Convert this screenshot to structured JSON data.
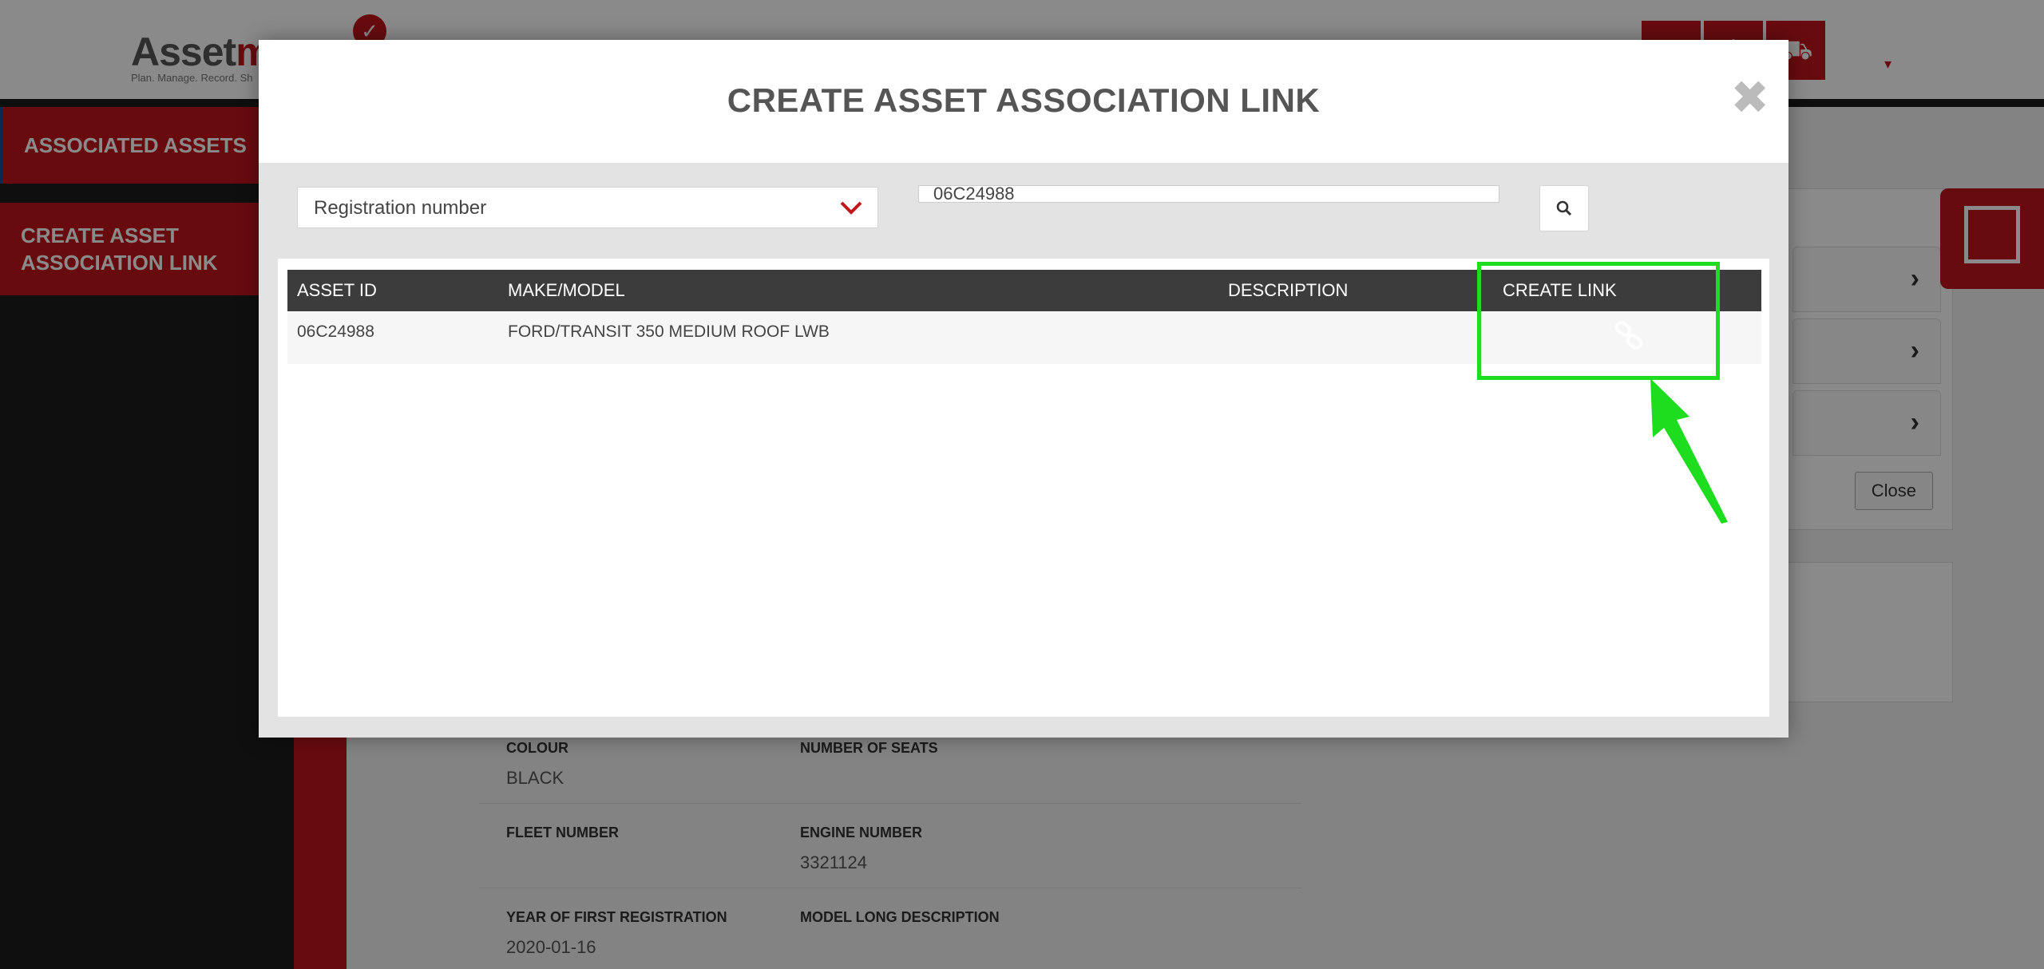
{
  "app": {
    "logo_text_main": "Asset",
    "logo_text_accent": "m",
    "logo_tagline": "Plan. Manage. Record. Sh",
    "logo_check": "✓"
  },
  "topbar": {
    "buttons": [
      "home-icon",
      "settings-icon",
      "truck-icon"
    ],
    "caret": "▾"
  },
  "sidebar": {
    "items": [
      {
        "label": "ASSOCIATED ASSETS"
      },
      {
        "label": "CREATE ASSET ASSOCIATION LINK"
      }
    ]
  },
  "details": {
    "rows": [
      {
        "left_label": "COLOUR",
        "left_value": "BLACK",
        "right_label": "NUMBER OF SEATS",
        "right_value": ""
      },
      {
        "left_label": "FLEET NUMBER",
        "left_value": "",
        "right_label": "ENGINE NUMBER",
        "right_value": "3321124"
      },
      {
        "left_label": "YEAR OF FIRST REGISTRATION",
        "left_value": "2020-01-16",
        "right_label": "MODEL LONG DESCRIPTION",
        "right_value": ""
      }
    ]
  },
  "right_panel": {
    "close_label": "Close"
  },
  "modal": {
    "title": "CREATE ASSET ASSOCIATION LINK",
    "close_glyph": "✖",
    "search_type": "Registration number",
    "search_value": "06C24988",
    "table": {
      "headers": [
        "ASSET ID",
        "MAKE/MODEL",
        "DESCRIPTION",
        "CREATE LINK"
      ],
      "rows": [
        {
          "asset_id": "06C24988",
          "make_model": "FORD/TRANSIT 350 MEDIUM ROOF LWB",
          "description": "",
          "link_icon": "link-icon"
        }
      ]
    }
  },
  "colors": {
    "brand_red": "#c0161c",
    "annotation_green": "#1edc1e",
    "header_dark": "#3c3c3c"
  }
}
